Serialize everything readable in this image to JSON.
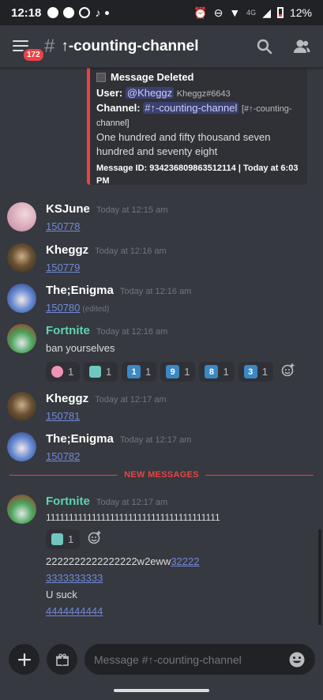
{
  "status": {
    "time": "12:18",
    "network": "4G",
    "battery": "12%"
  },
  "header": {
    "badge": "172",
    "hash": "#",
    "channel": "↑-counting-channel"
  },
  "embed": {
    "title": "Message Deleted",
    "user_label": "User:",
    "user_mention": "@Kheggz",
    "user_tag": "Kheggz#6643",
    "channel_label": "Channel:",
    "channel_mention": "#↑-counting-channel",
    "channel_tag_a": "[#↑-counting-",
    "channel_tag_b": "channel]",
    "content_a": "One hundred and fifty thousand seven",
    "content_b": "hundred and seventy eight",
    "footer_a": "Message ID: 934236809863512114 | Today at 6:03",
    "footer_b": "PM"
  },
  "messages": [
    {
      "user": "KSJune",
      "time": "Today at 12:15 am",
      "text": "150778"
    },
    {
      "user": "Kheggz",
      "time": "Today at 12:16 am",
      "text": "150779"
    },
    {
      "user": "The;Enigma",
      "time": "Today at 12:16 am",
      "text": "150780",
      "edited": "(edited)"
    },
    {
      "user": "Fortnite",
      "time": "Today at 12:16 am",
      "text": "ban yourselves"
    },
    {
      "user": "Kheggz",
      "time": "Today at 12:17 am",
      "text": "150781"
    },
    {
      "user": "The;Enigma",
      "time": "Today at 12:17 am",
      "text": "150782"
    },
    {
      "user": "Fortnite",
      "time": "Today at 12:17 am",
      "line1": "11111111111111111111111111111111111111",
      "line2a": "2222222222222222w2eww",
      "line2b": "32222",
      "line3": "3333333333",
      "line4": "U suck",
      "line5": "4444444444"
    }
  ],
  "reactions_a": [
    {
      "emoji": "pink-face",
      "count": "1"
    },
    {
      "emoji": "teal-shirt",
      "count": "1"
    },
    {
      "emoji": "keycap",
      "key": "1",
      "count": "1"
    },
    {
      "emoji": "keycap",
      "key": "9",
      "count": "1"
    },
    {
      "emoji": "keycap",
      "key": "8",
      "count": "1"
    },
    {
      "emoji": "keycap",
      "key": "3",
      "count": "1"
    }
  ],
  "reactions_b": [
    {
      "emoji": "teal-shirt",
      "count": "1"
    }
  ],
  "divider": "NEW MESSAGES",
  "input": {
    "placeholder": "Message #↑-counting-channel"
  },
  "colors": {
    "background": "#36393f",
    "new_messages": "#ed4245",
    "link": "#7289da",
    "fortnite_name": "#5fd3b3"
  }
}
